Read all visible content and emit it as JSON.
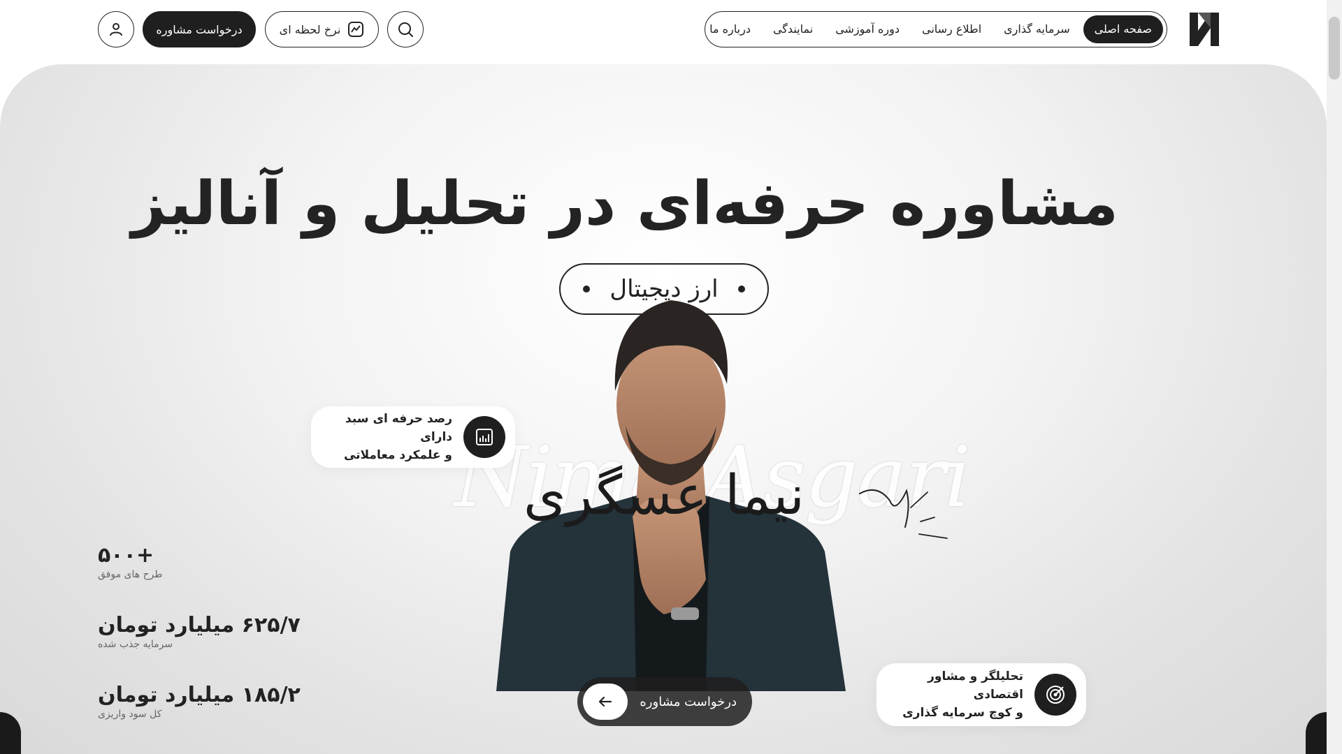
{
  "header": {
    "nav": [
      {
        "label": "صفحه اصلی",
        "active": true
      },
      {
        "label": "سرمایه گذاری"
      },
      {
        "label": "اطلاع رسانی"
      },
      {
        "label": "دوره آموزشی"
      },
      {
        "label": "نمایندگی"
      },
      {
        "label": "درباره ما"
      }
    ],
    "rate_button_label": "نرخ لحظه ای",
    "consult_button_label": "درخواست مشاوره",
    "icons": {
      "logo": "logo-n-mark",
      "search": "search-icon",
      "rate": "chart-icon",
      "user": "user-icon"
    }
  },
  "hero": {
    "title": "مشاوره حرفه‌ای در تحلیل و آنالیز",
    "pill_label": "ارز دیجیتال",
    "script_name": "Nima Asgari",
    "name": "نیما عسگری",
    "card_left": {
      "line1": "رصد حرفه ای سبد دارای",
      "line2": "و علمکرد معاملاتی",
      "icon": "chart-icon"
    },
    "card_right": {
      "line1": "تحلیلگر و مشاور اقتصادی",
      "line2": "و کوچ سرمایه گذاری",
      "icon": "target-icon"
    },
    "cta_label": "درخواست مشاوره",
    "cta_icon": "arrow-left-icon"
  },
  "stats": [
    {
      "value": "+۵۰۰",
      "label": "طرح های موفق"
    },
    {
      "value": "۶۲۵/۷ میلیارد تومان",
      "label": "سرمایه جذب شده"
    },
    {
      "value": "۱۸۵/۲ میلیارد تومان",
      "label": "کل سود واریزی"
    }
  ],
  "colors": {
    "dark": "#1f1f1f",
    "background": "#ffffff",
    "hero_bg": "#e4e4e4"
  }
}
